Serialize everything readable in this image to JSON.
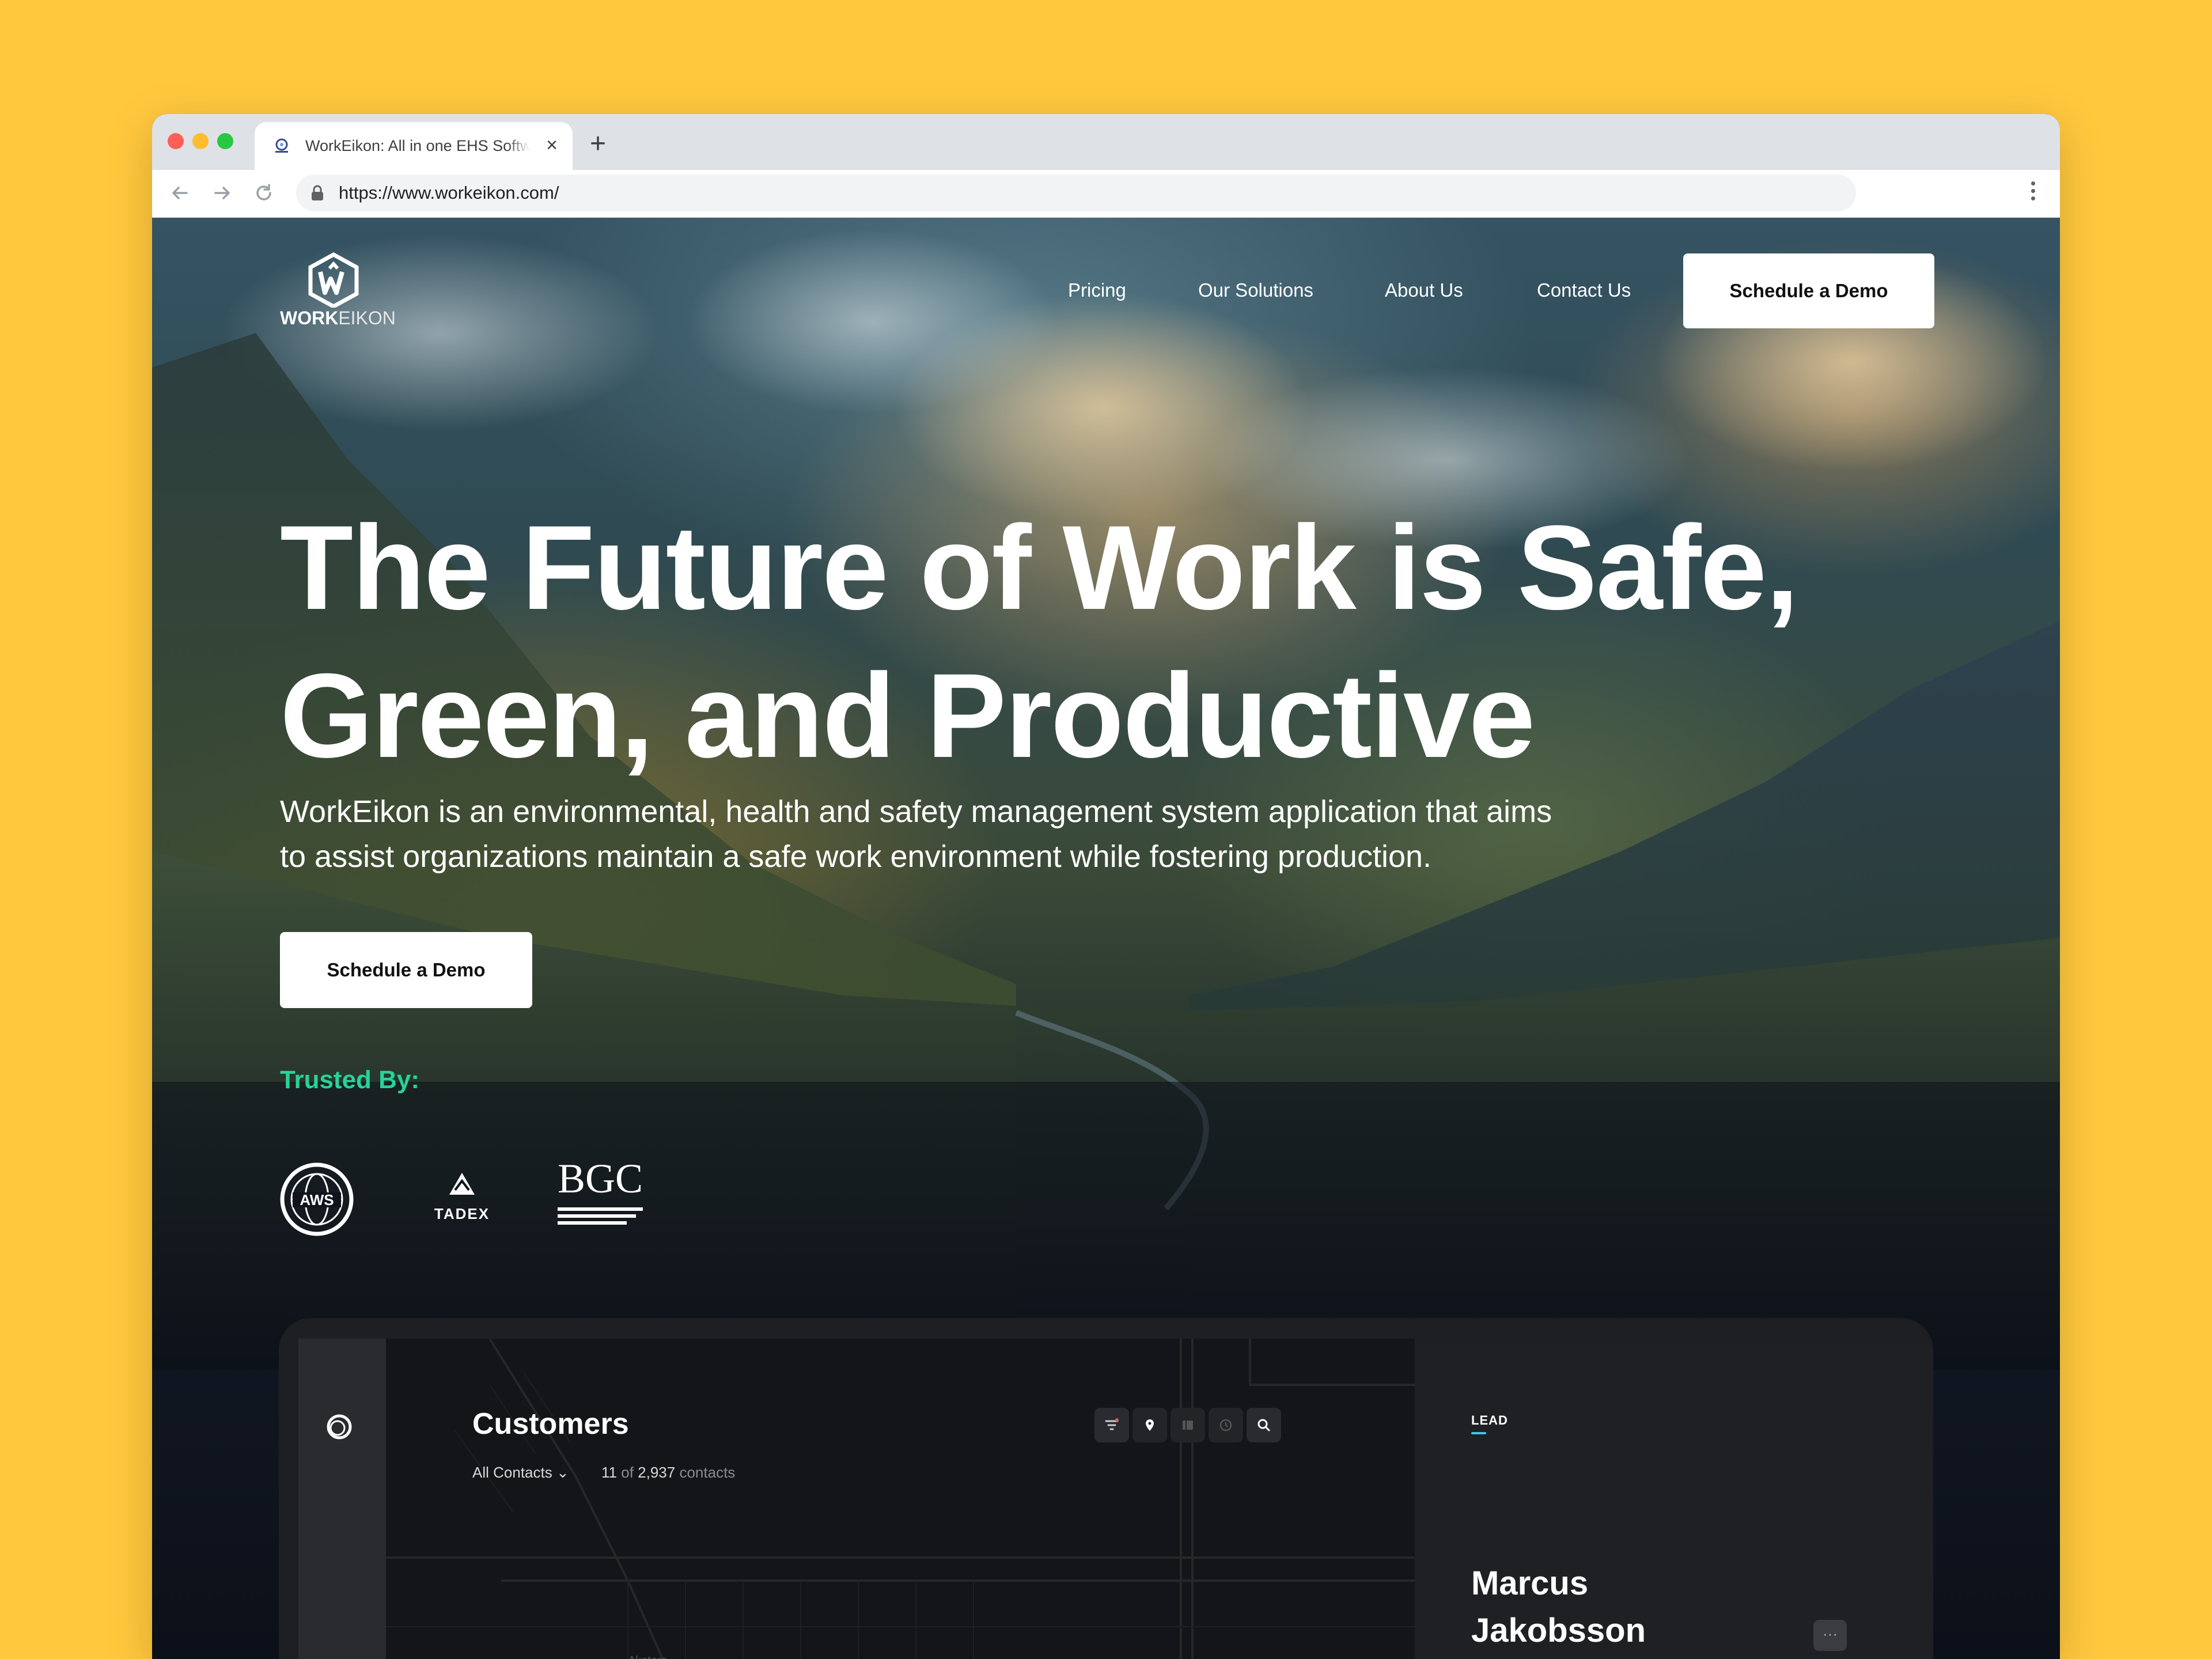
{
  "browser": {
    "tab_title": "WorkEikon: All in one EHS Software",
    "url": "https://www.workeikon.com/"
  },
  "nav": {
    "logo_text_bold": "WORK",
    "logo_text_light": "EIKON",
    "links": [
      "Pricing",
      "Our Solutions",
      "About Us",
      "Contact Us"
    ],
    "cta": "Schedule a Demo"
  },
  "hero": {
    "title_line1": "The Future of Work is Safe,",
    "title_line2": "Green, and Productive",
    "subtitle_line1": "WorkEikon is an environmental, health and safety management system application that aims",
    "subtitle_line2": "to assist organizations maintain a safe work environment while fostering production.",
    "cta": "Schedule a Demo"
  },
  "trusted": {
    "label": "Trusted By:",
    "logos": [
      "AWS",
      "TADEX",
      "BGC"
    ]
  },
  "dashboard": {
    "title": "Customers",
    "filter": "All Contacts",
    "count_shown": "11",
    "count_of": "of",
    "count_total": "2,937",
    "count_unit": "contacts",
    "map_label": "Akatora",
    "lead_label": "LEAD",
    "lead_name_first": "Marcus",
    "lead_name_last": "Jakobsson",
    "more": "···"
  },
  "colors": {
    "page_background": "#FFC83D",
    "trusted_accent": "#27D39A",
    "lead_accent": "#3EC6E0"
  }
}
